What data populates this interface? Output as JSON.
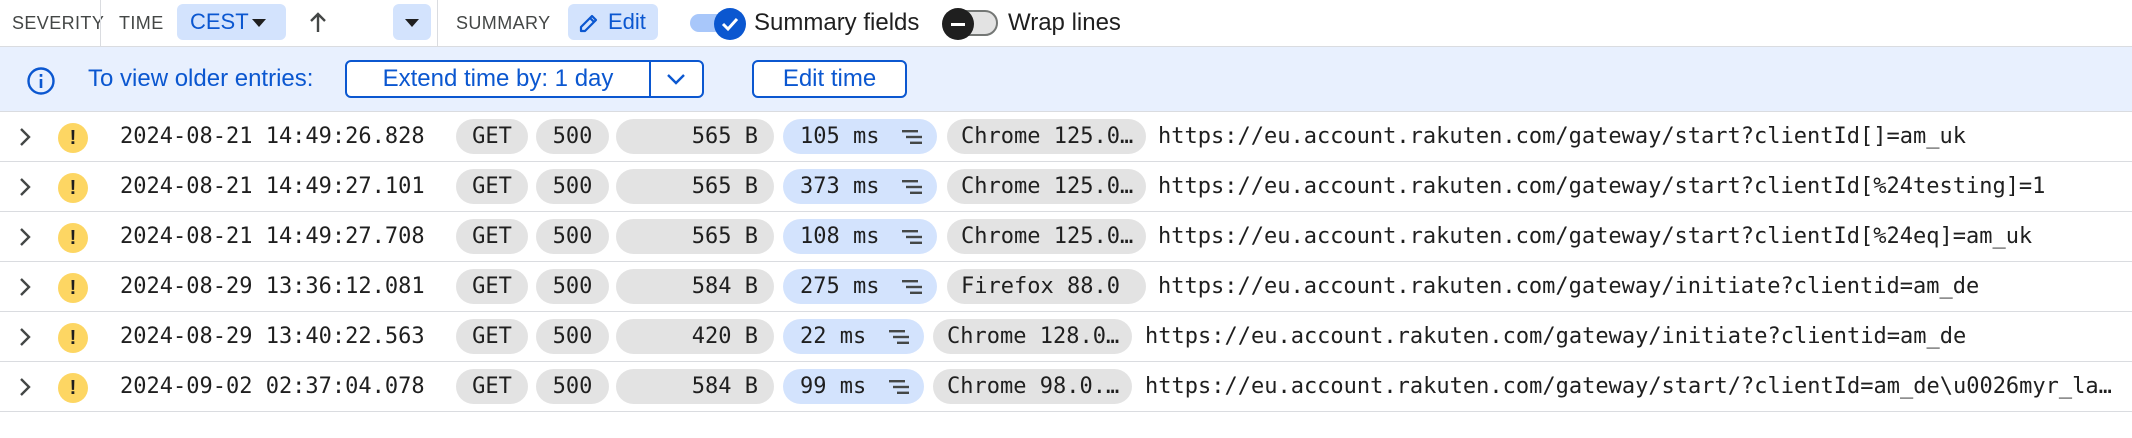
{
  "header": {
    "severity_label": "SEVERITY",
    "time_label": "TIME",
    "timezone": "CEST",
    "summary_label": "SUMMARY",
    "edit_label": "Edit",
    "summary_fields_label": "Summary fields",
    "summary_fields_on": true,
    "wrap_lines_label": "Wrap lines",
    "wrap_lines_on": false
  },
  "banner": {
    "message": "To view older entries:",
    "extend_label": "Extend time by: 1 day",
    "edit_time_label": "Edit time"
  },
  "colors": {
    "accent": "#0b57d0",
    "chip_bg": "#d3e3fd",
    "banner_bg": "#e8f0fe",
    "warning": "#fdd663",
    "pill_bg": "#e3e3e3"
  },
  "rows": [
    {
      "severity": "!",
      "timestamp": "2024-08-21 14:49:26.828",
      "method": "GET",
      "status": "500",
      "size": "565 B",
      "latency": "105 ms",
      "user_agent": "Chrome 125.0…",
      "url": "https://eu.account.rakuten.com/gateway/start?clientId[]=am_uk"
    },
    {
      "severity": "!",
      "timestamp": "2024-08-21 14:49:27.101",
      "method": "GET",
      "status": "500",
      "size": "565 B",
      "latency": "373 ms",
      "user_agent": "Chrome 125.0…",
      "url": "https://eu.account.rakuten.com/gateway/start?clientId[%24testing]=1"
    },
    {
      "severity": "!",
      "timestamp": "2024-08-21 14:49:27.708",
      "method": "GET",
      "status": "500",
      "size": "565 B",
      "latency": "108 ms",
      "user_agent": "Chrome 125.0…",
      "url": "https://eu.account.rakuten.com/gateway/start?clientId[%24eq]=am_uk"
    },
    {
      "severity": "!",
      "timestamp": "2024-08-29 13:36:12.081",
      "method": "GET",
      "status": "500",
      "size": "584 B",
      "latency": "275 ms",
      "user_agent": "Firefox 88.0",
      "url": "https://eu.account.rakuten.com/gateway/initiate?clientid=am_de"
    },
    {
      "severity": "!",
      "timestamp": "2024-08-29 13:40:22.563",
      "method": "GET",
      "status": "500",
      "size": "420 B",
      "latency": "22 ms",
      "user_agent": "Chrome 128.0…",
      "url": "https://eu.account.rakuten.com/gateway/initiate?clientid=am_de"
    },
    {
      "severity": "!",
      "timestamp": "2024-09-02 02:37:04.078",
      "method": "GET",
      "status": "500",
      "size": "584 B",
      "latency": "99 ms",
      "user_agent": "Chrome 98.0.…",
      "url": "https://eu.account.rakuten.com/gateway/start/?clientId=am_de\\u0026myr_la…"
    }
  ]
}
